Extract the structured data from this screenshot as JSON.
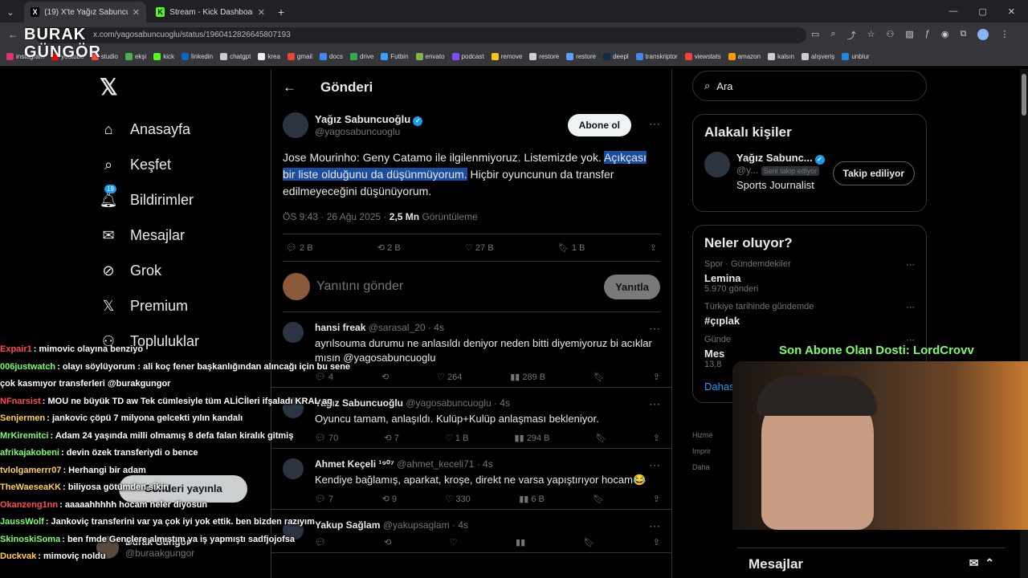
{
  "browser": {
    "tabs": [
      {
        "label": "(19) X'te Yağız Sabuncuoğlu: \"Jo",
        "icon": "x-icon",
        "active": true
      },
      {
        "label": "Stream - Kick Dashboard",
        "icon": "kick-icon",
        "active": false
      }
    ],
    "new_tab": "+",
    "url": "x.com/yagosabuncuoglu/status/1960412826645807193",
    "bookmarks": [
      "instagram",
      "youtube",
      "studio",
      "ekşi",
      "kick",
      "linkedin",
      "chatgpt",
      "krea",
      "gmail",
      "docs",
      "drive",
      "Futbin",
      "envato",
      "podcast",
      "remove",
      "restore",
      "restore",
      "deepl",
      "transkriptor",
      "viewstats",
      "amazon",
      "kalsın",
      "alışveriş",
      "unblur"
    ]
  },
  "watermark": {
    "line1": "BURAK",
    "line2": "GÜNGÖR"
  },
  "nav": {
    "items": [
      {
        "label": "Anasayfa",
        "icon": "home-icon"
      },
      {
        "label": "Keşfet",
        "icon": "search-icon"
      },
      {
        "label": "Bildirimler",
        "icon": "bell-icon",
        "badge": "19"
      },
      {
        "label": "Mesajlar",
        "icon": "mail-icon"
      },
      {
        "label": "Grok",
        "icon": "grok-icon"
      },
      {
        "label": "Premium",
        "icon": "x-icon"
      },
      {
        "label": "Topluluklar",
        "icon": "people-icon"
      }
    ],
    "post_button": "Gönderi yayınla",
    "profile": {
      "name": "Burak Güngör",
      "handle": "@buraakgungor"
    }
  },
  "main": {
    "title": "Gönderi",
    "post": {
      "name": "Yağız Sabuncuoğlu",
      "handle": "@yagosabuncuoglu",
      "subscribe": "Abone ol",
      "text_before": "Jose Mourinho: Geny Catamo ile ilgilenmiyoruz. Listemizde yok. ",
      "text_highlight": "Açıkçası bir liste olduğunu da düşünmüyorum.",
      "text_after": " Hiçbir oyuncunun da transfer edilmeyeceğini düşünüyorum.",
      "time": "ÖS 9:43 · 26 Ağu 2025 · ",
      "views": "2,5 Mn",
      "views_label": " Görüntüleme",
      "stats": {
        "replies": "2 B",
        "reposts": "2 B",
        "likes": "27 B",
        "bookmarks": "1 B"
      }
    },
    "reply_box": {
      "placeholder": "Yanıtını gönder",
      "button": "Yanıtla"
    },
    "replies": [
      {
        "name": "hansi freak",
        "handle": "@sarasal_20 · 4s",
        "text": "ayrılsouma durumu ne anlasıldı deniyor neden bitti diyemiyoruz bi acıklar mısın @yagosabuncuoglu",
        "stats": [
          "4",
          "",
          "264",
          "289 B"
        ]
      },
      {
        "name": "Yağız Sabuncuoğlu",
        "handle": "@yagosabuncuoglu · 4s",
        "text": "Oyuncu tamam, anlaşıldı. Kulüp+Kulüp anlaşması bekleniyor.",
        "stats": [
          "70",
          "7",
          "1 B",
          "294 B"
        ]
      },
      {
        "name": "Ahmet Keçeli ¹⁹⁰⁷",
        "handle": "@ahmet_keceli71 · 4s",
        "text": "Kendiye bağlamış, aparkat, kroşe, direkt ne varsa yapıştırıyor hocam😂",
        "stats": [
          "7",
          "9",
          "330",
          "6 B"
        ]
      },
      {
        "name": "Yakup Sağlam",
        "handle": "@yakupsaglam · 4s",
        "text": "",
        "stats": [
          "",
          "",
          "",
          ""
        ]
      }
    ]
  },
  "sidebar": {
    "search_placeholder": "Ara",
    "related": {
      "title": "Alakalı kişiler",
      "name": "Yağız Sabunc...",
      "handle": "@y...",
      "follows_you": "Seni takip ediyor",
      "button": "Takip ediliyor",
      "bio": "Sports Journalist"
    },
    "trends": {
      "title": "Neler oluyor?",
      "items": [
        {
          "context": "Spor · Gündemdekiler",
          "name": "Lemina",
          "count": "5.970 gönderi"
        },
        {
          "context": "Türkiye tarihinde gündemde",
          "name": "#çıplak",
          "count": ""
        },
        {
          "context": "Günde",
          "name": "Mes",
          "count": "13,8"
        }
      ],
      "more": "Dahası"
    },
    "footer": [
      "Hizme",
      "Imprir",
      "Daha"
    ],
    "messages": "Mesajlar"
  },
  "overlay": {
    "last_sub": "Son Abone Olan Dosti: LordCrovv",
    "chat": [
      {
        "user": "Expair1",
        "color": "#ff4d4d",
        "msg": "mimovic olayına benziyo"
      },
      {
        "user": "006justwatch",
        "color": "#7cff68",
        "msg": "olayı söylüyorum : ali koç fener başkanlığından alıncağı için bu sene çok kasmıyor transferleri @burakgungor"
      },
      {
        "user": "NFnarsist",
        "color": "#ff4d4d",
        "msg": "MOU ne büyük TD aw Tek cümlesiyle tüm ALİCİleri ifşaladı KRAL aq"
      },
      {
        "user": "Senjermen",
        "color": "#ffd24d",
        "msg": "jankovic çöpü 7 milyona gelcekti yılın kandalı"
      },
      {
        "user": "MrKiremitci",
        "color": "#7cff68",
        "msg": "Adam 24 yaşında milli olmamış 8 defa falan kiralık gitmiş"
      },
      {
        "user": "afrikajakobeni",
        "color": "#7cff68",
        "msg": "devin özek transferiydi o bence"
      },
      {
        "user": "tvlolgamerrr07",
        "color": "#ffd24d",
        "msg": "Herhangi bir adam"
      },
      {
        "user": "TheWaeseaKK",
        "color": "#ffd24d",
        "msg": "biliyosa götümden sikin"
      },
      {
        "user": "Okanzeng1nn",
        "color": "#ff4d4d",
        "msg": "aaaaahhhhh hocam neler diyosun"
      },
      {
        "user": "JaussWolf",
        "color": "#7cff68",
        "msg": "Jankoviç transferini var ya çok iyi yok ettik. ben bizden razıyım"
      },
      {
        "user": "SkinoskiSoma",
        "color": "#7cff68",
        "msg": "ben fmde Gençlere almıştım ya iş yapmıştı sadfjojofsa"
      },
      {
        "user": "Duckvak",
        "color": "#ffd24d",
        "msg": "mimoviç noldu"
      }
    ]
  }
}
